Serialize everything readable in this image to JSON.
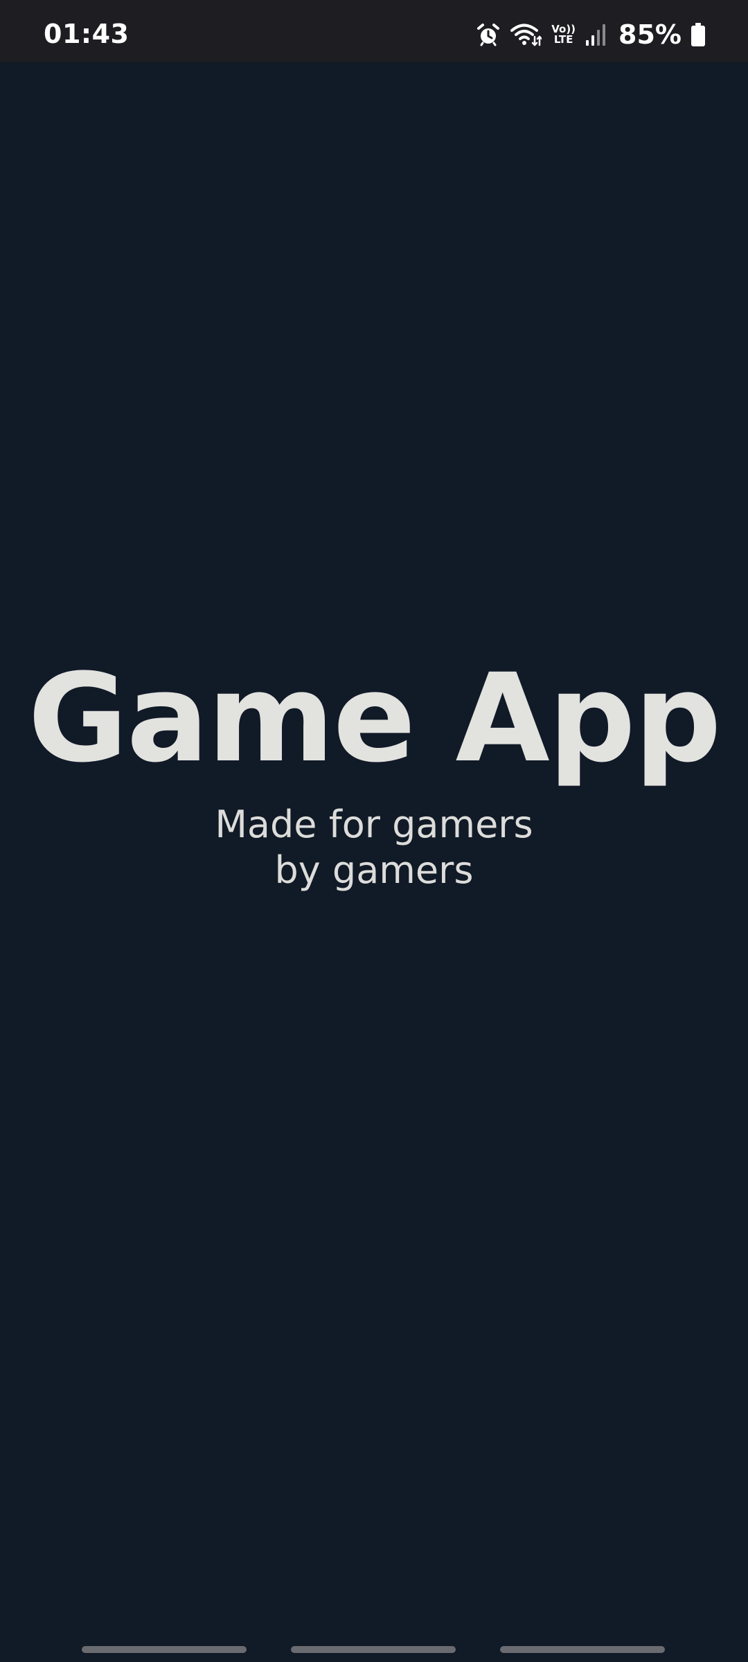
{
  "status_bar": {
    "time": "01:43",
    "battery_percent": "85%",
    "volte_top": "Vo))",
    "volte_bottom": "LTE",
    "icons": [
      "alarm-icon",
      "wifi-icon",
      "volte-icon",
      "signal-icon",
      "battery-icon"
    ]
  },
  "splash": {
    "title": "Game App",
    "subtitle_line1": "Made for gamers",
    "subtitle_line2": "by gamers"
  },
  "colors": {
    "background": "#111a27",
    "status_bar": "#1e1d21",
    "text": "#e2e2df",
    "nav_pill": "#6a6b70"
  }
}
